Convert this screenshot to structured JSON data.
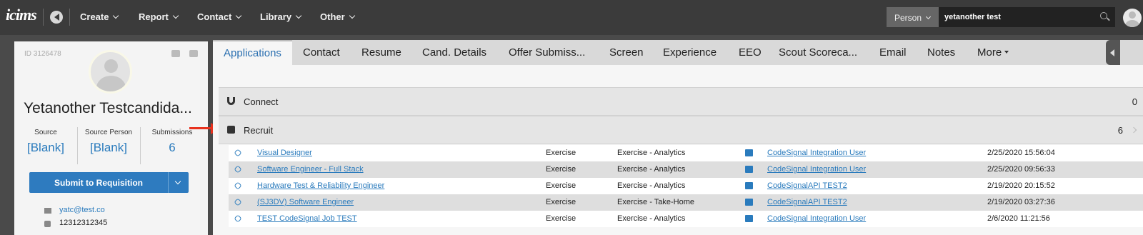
{
  "nav": {
    "logo": "icims",
    "items": [
      {
        "label": "Create"
      },
      {
        "label": "Report"
      },
      {
        "label": "Contact"
      },
      {
        "label": "Library"
      },
      {
        "label": "Other"
      }
    ],
    "search_scope": "Person",
    "search_value": "yetanother test"
  },
  "candidate": {
    "id": "ID 3126478",
    "name": "Yetanother Testcandida...",
    "stats": [
      {
        "label": "Source",
        "value": "[Blank]"
      },
      {
        "label": "Source Person",
        "value": "[Blank]"
      },
      {
        "label": "Submissions",
        "value": "6"
      }
    ],
    "submit_label": "Submit to Requisition",
    "email": "yatc@test.co",
    "phone": "12312312345"
  },
  "tabs": [
    {
      "label": "Applications"
    },
    {
      "label": "Contact"
    },
    {
      "label": "Resume"
    },
    {
      "label": "Cand. Details"
    },
    {
      "label": "Offer Submiss..."
    },
    {
      "label": "Screen"
    },
    {
      "label": "Experience"
    },
    {
      "label": "EEO"
    },
    {
      "label": "Scout Scoreca..."
    },
    {
      "label": "Email"
    },
    {
      "label": "Notes"
    },
    {
      "label": "More"
    }
  ],
  "sections": {
    "connect": {
      "title": "Connect",
      "count": "0"
    },
    "recruit": {
      "title": "Recruit",
      "count": "6"
    }
  },
  "rows": [
    {
      "job": "Visual Designer",
      "type": "Exercise",
      "subtype": "Exercise - Analytics",
      "user": "CodeSignal Integration User",
      "date": "2/25/2020 15:56:04"
    },
    {
      "job": "Software Engineer - Full Stack",
      "type": "Exercise",
      "subtype": "Exercise - Analytics",
      "user": "CodeSignal Integration User",
      "date": "2/25/2020 09:56:33"
    },
    {
      "job": "Hardware Test & Reliability Engineer",
      "type": "Exercise",
      "subtype": "Exercise - Analytics",
      "user": "CodeSignalAPI TEST2",
      "date": "2/19/2020 20:15:52"
    },
    {
      "job": "(SJ3DV) Software Engineer",
      "type": "Exercise",
      "subtype": "Exercise - Take-Home",
      "user": "CodeSignalAPI TEST2",
      "date": "2/19/2020 03:27:36"
    },
    {
      "job": "TEST CodeSignal Job TEST",
      "type": "Exercise",
      "subtype": "Exercise - Analytics",
      "user": "CodeSignal Integration User",
      "date": "2/6/2020 11:21:56"
    }
  ],
  "colors": {
    "accent": "#2a7bbd",
    "topbar": "#3b3b3b",
    "arrow": "#e8321e"
  }
}
